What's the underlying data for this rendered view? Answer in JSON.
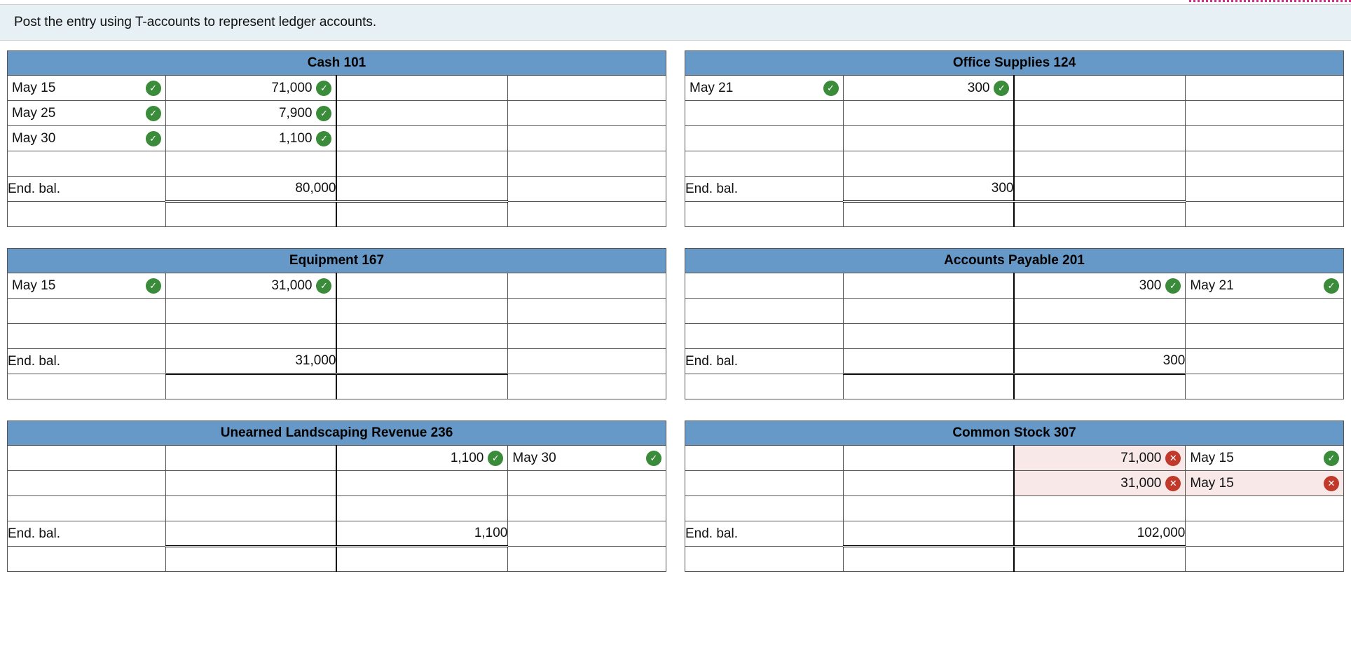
{
  "instruction": "Post the entry using T-accounts to represent ledger accounts.",
  "end_bal_label": "End. bal.",
  "accounts": {
    "cash": {
      "title": "Cash 101",
      "rows": [
        {
          "d_date": "May 15",
          "d_amt": "71,000",
          "d_date_ok": true,
          "d_amt_ok": true
        },
        {
          "d_date": "May 25",
          "d_amt": "7,900",
          "d_date_ok": true,
          "d_amt_ok": true
        },
        {
          "d_date": "May 30",
          "d_amt": "1,100",
          "d_date_ok": true,
          "d_amt_ok": true
        }
      ],
      "end_debit": "80,000",
      "end_credit": ""
    },
    "office": {
      "title": "Office Supplies 124",
      "rows": [
        {
          "d_date": "May 21",
          "d_amt": "300",
          "d_date_ok": true,
          "d_amt_ok": true
        }
      ],
      "end_debit": "300",
      "end_credit": ""
    },
    "equip": {
      "title": "Equipment 167",
      "rows": [
        {
          "d_date": "May 15",
          "d_amt": "31,000",
          "d_date_ok": true,
          "d_amt_ok": true
        }
      ],
      "end_debit": "31,000",
      "end_credit": ""
    },
    "ap": {
      "title": "Accounts Payable 201",
      "rows": [
        {
          "c_date": "May 21",
          "c_amt": "300",
          "c_date_ok": true,
          "c_amt_ok": true
        }
      ],
      "end_debit": "",
      "end_credit": "300"
    },
    "unearned": {
      "title": "Unearned Landscaping Revenue 236",
      "rows": [
        {
          "c_date": "May 30",
          "c_amt": "1,100",
          "c_date_ok": true,
          "c_amt_ok": true
        }
      ],
      "end_debit": "",
      "end_credit": "1,100"
    },
    "cs": {
      "title": "Common Stock 307",
      "rows": [
        {
          "c_date": "May 15",
          "c_amt": "71,000",
          "c_date_ok": true,
          "c_amt_ok": false,
          "c_amt_wrong": true
        },
        {
          "c_date": "May 15",
          "c_amt": "31,000",
          "c_date_ok": false,
          "c_date_wrong": true,
          "c_amt_ok": false,
          "c_amt_wrong": true
        }
      ],
      "end_debit": "",
      "end_credit": "102,000"
    }
  }
}
